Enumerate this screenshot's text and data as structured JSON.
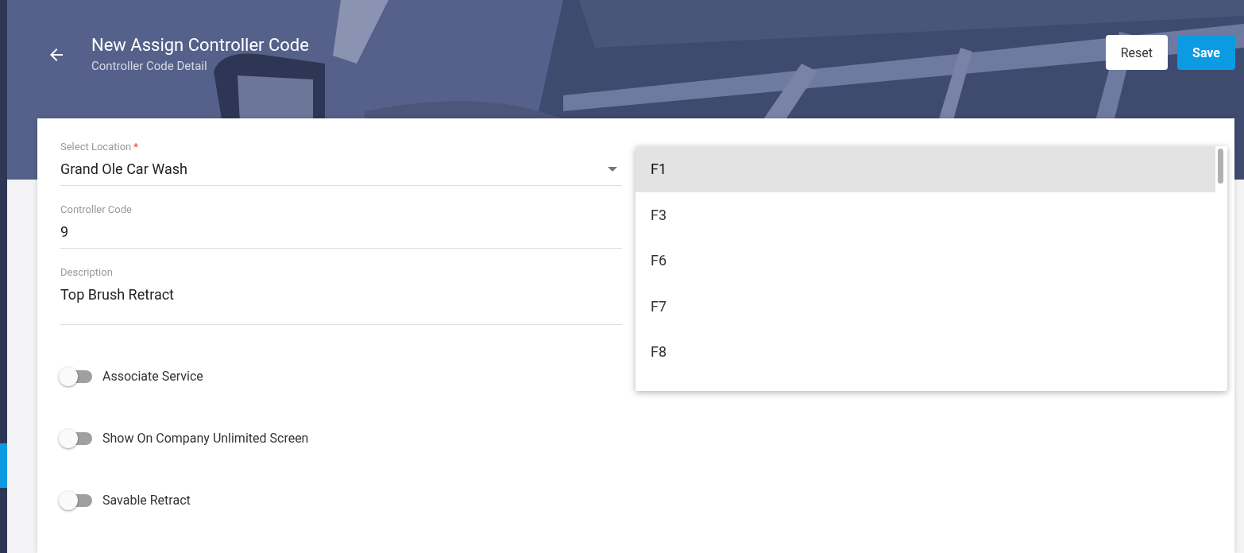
{
  "header": {
    "title": "New Assign Controller Code",
    "subtitle": "Controller Code Detail",
    "buttons": [
      {
        "label": "Reset",
        "kind": "secondary"
      },
      {
        "label": "Save",
        "kind": "primary"
      }
    ]
  },
  "sidebar": {
    "active_marker": true
  },
  "form": {
    "fields": [
      {
        "label": "Select Location",
        "required_mark": "*",
        "value": "Grand Ole Car Wash",
        "kind": "select"
      },
      {
        "label": "Controller Code",
        "value": "9",
        "kind": "text"
      },
      {
        "label": "Description",
        "value": "Top Brush Retract",
        "kind": "textarea"
      }
    ],
    "toggles": [
      {
        "label": "Associate Service",
        "on": false
      },
      {
        "label": "Show On Company Unlimited Screen",
        "on": false
      },
      {
        "label": "Savable Retract",
        "on": false
      }
    ]
  },
  "dropdown": {
    "options": [
      {
        "label": "F1",
        "selected": true
      },
      {
        "label": "F3",
        "selected": false
      },
      {
        "label": "F6",
        "selected": false
      },
      {
        "label": "F7",
        "selected": false
      },
      {
        "label": "F8",
        "selected": false
      }
    ]
  }
}
